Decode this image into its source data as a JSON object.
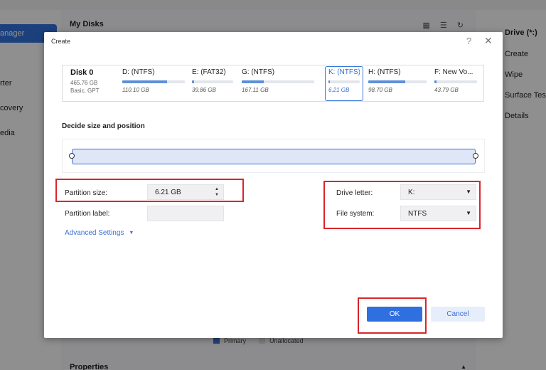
{
  "background": {
    "app_title_fragment": "",
    "sidebar_items": [
      {
        "label": "anager",
        "active": true
      },
      {
        "label": "rter",
        "active": false
      },
      {
        "label": "covery",
        "active": false
      },
      {
        "label": "edia",
        "active": false
      }
    ],
    "content_title": "My Disks",
    "legend": [
      {
        "label": "Primary",
        "color": "#3c6fd0"
      },
      {
        "label": "Unallocated",
        "color": "#d9d9d9"
      }
    ],
    "properties_label": "Properties",
    "right_panel": {
      "title": "Drive (*:)",
      "items": [
        "Create",
        "Wipe",
        "Surface Test",
        "Details"
      ]
    }
  },
  "dialog": {
    "title": "Create",
    "help_icon": "?",
    "close_icon": "✕",
    "disk": {
      "name": "Disk 0",
      "size": "465.76 GB",
      "type": "Basic, GPT"
    },
    "partitions": [
      {
        "name": "D: (NTFS)",
        "size": "110.10 GB",
        "fill": 0.72,
        "selected": false
      },
      {
        "name": "E: (FAT32)",
        "size": "39.86 GB",
        "fill": 0.05,
        "selected": false
      },
      {
        "name": "G: (NTFS)",
        "size": "167.11 GB",
        "fill": 0.3,
        "selected": false
      },
      {
        "name": "K: (NTFS)",
        "size": "6.21 GB",
        "fill": 0.04,
        "selected": true
      },
      {
        "name": "H: (NTFS)",
        "size": "98.70 GB",
        "fill": 0.64,
        "selected": false
      },
      {
        "name": "F: New Vo...",
        "size": "43.79 GB",
        "fill": 0.05,
        "selected": false
      }
    ],
    "section_title": "Decide size and position",
    "partition_size_label": "Partition size:",
    "partition_size_value": "6.21 GB",
    "partition_label_label": "Partition label:",
    "partition_label_value": "",
    "advanced_settings": "Advanced Settings",
    "drive_letter_label": "Drive letter:",
    "drive_letter_value": "K:",
    "file_system_label": "File system:",
    "file_system_value": "NTFS",
    "ok_label": "OK",
    "cancel_label": "Cancel"
  },
  "colors": {
    "accent": "#2f6fe0",
    "highlight": "#d9262a"
  }
}
